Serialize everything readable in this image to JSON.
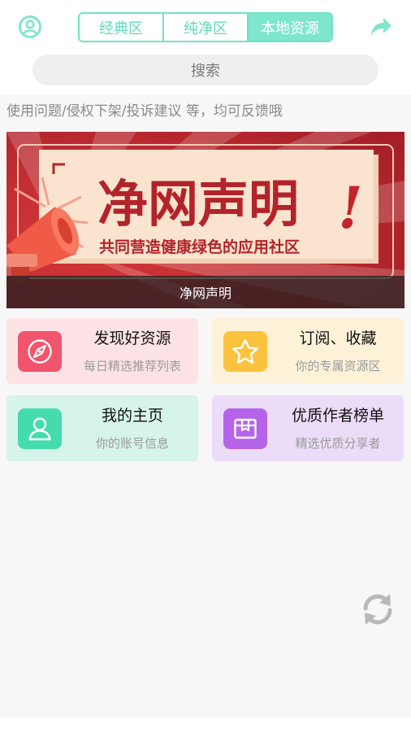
{
  "header": {
    "avatar_icon": "user-circle-icon",
    "share_icon": "share-arrow-icon",
    "tabs": [
      {
        "label": "经典区",
        "active": false
      },
      {
        "label": "纯净区",
        "active": false
      },
      {
        "label": "本地资源",
        "active": true
      }
    ],
    "accent_color": "#6fe3c6"
  },
  "search": {
    "placeholder": "搜索"
  },
  "notice": {
    "text": "使用问题/侵权下架/投诉建议 等，均可反馈哦"
  },
  "banner": {
    "headline": "净网声明",
    "exclamation": "!",
    "slogan": "共同营造健康绿色的应用社区",
    "caption": "净网声明",
    "icon": "megaphone-icon"
  },
  "cards": [
    {
      "title": "发现好资源",
      "subtitle": "每日精选推荐列表",
      "icon": "compass-icon",
      "bg": "#fde3e6",
      "icon_bg": "#f1546d"
    },
    {
      "title": "订阅、收藏",
      "subtitle": "你的专属资源区",
      "icon": "star-icon",
      "bg": "#fdf2d8",
      "icon_bg": "#fbc33d"
    },
    {
      "title": "我的主页",
      "subtitle": "你的账号信息",
      "icon": "user-icon",
      "bg": "#d7f4ea",
      "icon_bg": "#44dcac"
    },
    {
      "title": "优质作者榜单",
      "subtitle": "精选优质分享者",
      "icon": "box-icon",
      "bg": "#ebdcf8",
      "icon_bg": "#b564ea"
    }
  ],
  "floating": {
    "refresh_icon": "refresh-icon"
  }
}
